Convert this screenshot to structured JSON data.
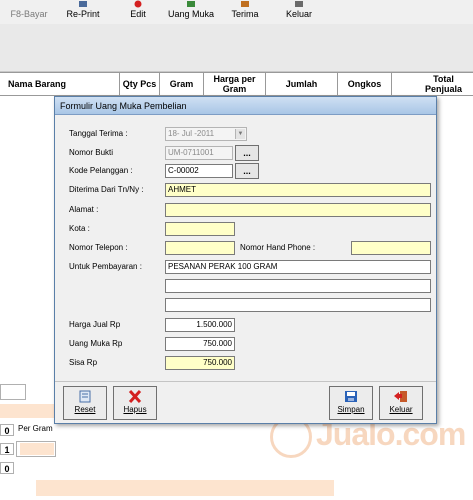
{
  "toolbar": {
    "items": [
      {
        "label": "F8-Bayar",
        "icon": "pay-icon"
      },
      {
        "label": "Re-Print",
        "icon": "print-icon"
      },
      {
        "label": "Edit",
        "icon": "edit-icon"
      },
      {
        "label": "Uang Muka",
        "icon": "wallet-icon"
      },
      {
        "label": "Terima",
        "icon": "receive-icon"
      },
      {
        "label": "Keluar",
        "icon": "exit-icon"
      }
    ]
  },
  "grid": {
    "columns": [
      "Nama Barang",
      "Qty Pcs",
      "Gram",
      "Harga per Gram",
      "Jumlah",
      "Ongkos",
      "Total Penjuala"
    ]
  },
  "background": {
    "per_gram_label": "Per Gram",
    "numbers": [
      "0",
      "1",
      "0"
    ]
  },
  "dialog": {
    "title": "Formulir Uang Muka Pembelian",
    "fields": {
      "tanggal_terima": {
        "label": "Tanggal Terima :",
        "value": "18-  Jul  -2011"
      },
      "nomor_bukti": {
        "label": "Nomor Bukti",
        "value": "UM-0711001"
      },
      "kode_pelanggan": {
        "label": "Kode Pelanggan  :",
        "value": "C-00002"
      },
      "diterima_dari": {
        "label": "Diterima Dari Tn/Ny :",
        "value": "AHMET"
      },
      "alamat": {
        "label": "Alamat :",
        "value": ""
      },
      "kota": {
        "label": "Kota :",
        "value": ""
      },
      "nomor_telepon": {
        "label": "Nomor Telepon  :",
        "value": ""
      },
      "nomor_hand_phone": {
        "label": "Nomor Hand Phone :",
        "value": ""
      },
      "untuk_pembayaran": {
        "label": "Untuk Pembayaran :",
        "lines": [
          "PESANAN PERAK 100 GRAM",
          "",
          ""
        ]
      },
      "harga_jual": {
        "label": "Harga Jual Rp",
        "value": "1.500.000"
      },
      "uang_muka": {
        "label": "Uang Muka Rp",
        "value": "750.000"
      },
      "sisa": {
        "label": "Sisa Rp",
        "value": "750.000"
      }
    },
    "ellipsis_label": "...",
    "buttons": {
      "reset": "Reset",
      "hapus": "Hapus",
      "simpan": "Simpan",
      "keluar": "Keluar"
    }
  },
  "watermark": {
    "text": "Jualo.com"
  },
  "colors": {
    "field_yellow": "#ffffc8",
    "title_bar": "#a9c6e6",
    "peach": "#fde4cf",
    "delete_red": "#d42020",
    "save_blue": "#2a62b8",
    "brand_orange": "#e8843a"
  }
}
